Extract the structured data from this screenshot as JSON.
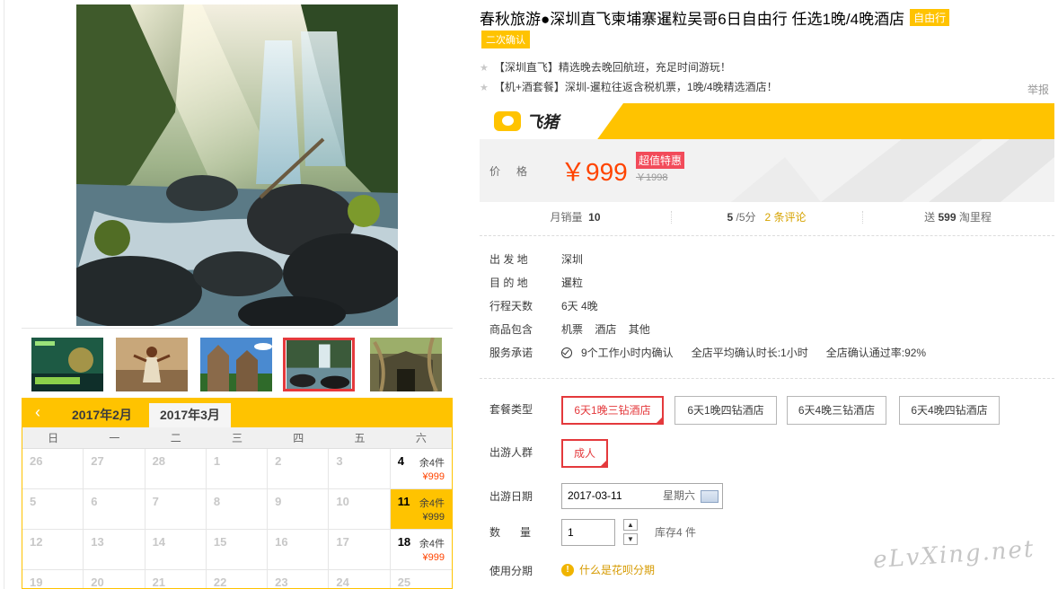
{
  "title": "春秋旅游●深圳直飞柬埔寨暹粒吴哥6日自由行 任选1晚/4晚酒店",
  "badge_ziyou": "自由行",
  "badge_confirm": "二次确认",
  "highlights": [
    "【深圳直飞】精选晚去晚回航班，充足时间游玩！",
    "【机+酒套餐】深圳-暹粒往返含税机票，1晚/4晚精选酒店！"
  ],
  "report": "举报",
  "brand": "飞猪",
  "price": {
    "label": "价格",
    "current": "￥999",
    "sale_tag": "超值特惠",
    "original": "￥1998"
  },
  "stats": {
    "monthly_sales_label": "月销量",
    "monthly_sales": "10",
    "rating": "5",
    "rating_suffix": "/5分",
    "reviews_link": "2 条评论",
    "points_prefix": "送",
    "points": "599",
    "points_suffix": "淘里程"
  },
  "info": [
    {
      "label": "出 发 地",
      "value": "深圳"
    },
    {
      "label": "目 的 地",
      "value": "暹粒"
    },
    {
      "label": "行程天数",
      "value": "6天 4晚"
    }
  ],
  "includes": {
    "label": "商品包含",
    "items": [
      "机票",
      "酒店",
      "其他"
    ]
  },
  "service": {
    "label": "服务承诺",
    "items": [
      "9个工作小时内确认",
      "全店平均确认时长:1小时",
      "全店确认通过率:92%"
    ]
  },
  "package": {
    "label": "套餐类型",
    "options": [
      "6天1晚三钻酒店",
      "6天1晚四钻酒店",
      "6天4晚三钻酒店",
      "6天4晚四钻酒店"
    ],
    "selected": 0
  },
  "crowd": {
    "label": "出游人群",
    "options": [
      "成人"
    ],
    "selected": 0
  },
  "travel_date": {
    "label": "出游日期",
    "value": "2017-03-11",
    "weekday": "星期六"
  },
  "quantity": {
    "label": "数量",
    "value": "1",
    "stock": "库存4 件"
  },
  "installment": {
    "label": "使用分期",
    "link": "什么是花呗分期"
  },
  "calendar": {
    "months": [
      "2017年2月",
      "2017年3月"
    ],
    "active_month": 1,
    "weekdays": [
      "日",
      "一",
      "二",
      "三",
      "四",
      "五",
      "六"
    ],
    "rows": [
      [
        {
          "d": "26"
        },
        {
          "d": "27"
        },
        {
          "d": "28"
        },
        {
          "d": "1"
        },
        {
          "d": "2"
        },
        {
          "d": "3"
        },
        {
          "d": "4",
          "stock": "余4件",
          "price": "¥999"
        }
      ],
      [
        {
          "d": "5"
        },
        {
          "d": "6"
        },
        {
          "d": "7"
        },
        {
          "d": "8"
        },
        {
          "d": "9"
        },
        {
          "d": "10"
        },
        {
          "d": "11",
          "stock": "余4件",
          "price": "¥999",
          "selected": true
        }
      ],
      [
        {
          "d": "12"
        },
        {
          "d": "13"
        },
        {
          "d": "14"
        },
        {
          "d": "15"
        },
        {
          "d": "16"
        },
        {
          "d": "17"
        },
        {
          "d": "18",
          "stock": "余4件",
          "price": "¥999"
        }
      ],
      [
        {
          "d": "19"
        },
        {
          "d": "20"
        },
        {
          "d": "21"
        },
        {
          "d": "22"
        },
        {
          "d": "23"
        },
        {
          "d": "24"
        },
        {
          "d": "25"
        }
      ]
    ]
  },
  "thumbnails": [
    {
      "name": "thumb-promo-banner",
      "kind": "promo"
    },
    {
      "name": "thumb-apsara-dancer",
      "kind": "dancer"
    },
    {
      "name": "thumb-bayon-temple",
      "kind": "temple"
    },
    {
      "name": "thumb-waterfall",
      "kind": "waterfall",
      "active": true
    },
    {
      "name": "thumb-ta-prohm-ruins",
      "kind": "ruins"
    }
  ],
  "watermark": "eLvXing.net"
}
